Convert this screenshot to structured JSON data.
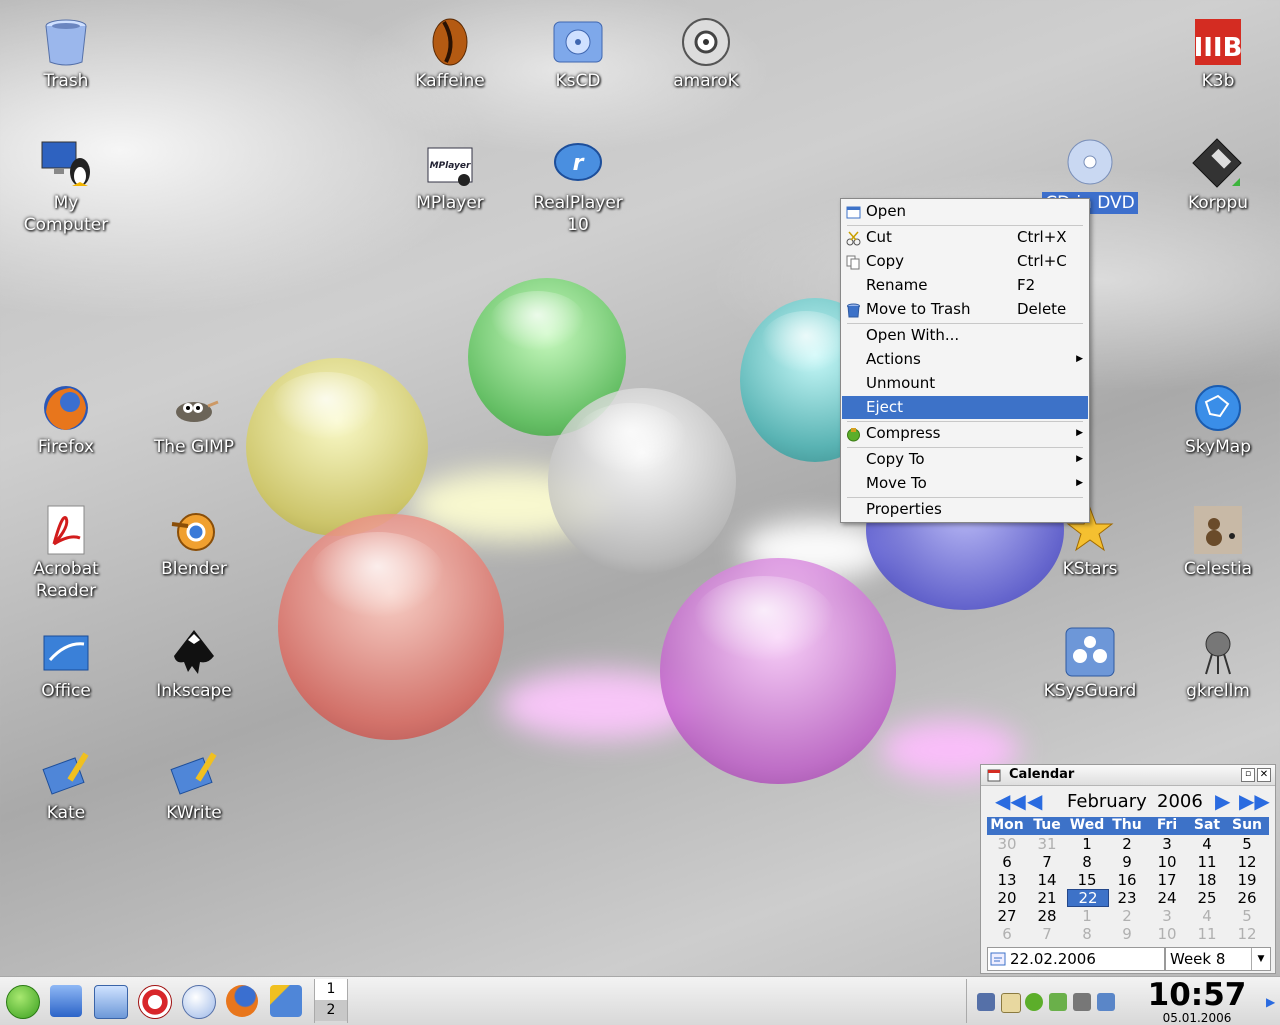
{
  "desktop": {
    "icons": [
      {
        "label": "Trash",
        "icon": "trash-icon"
      },
      {
        "label": "Kaffeine",
        "icon": "kaffeine-icon"
      },
      {
        "label": "KsCD",
        "icon": "kscd-icon"
      },
      {
        "label": "amaroK",
        "icon": "amarok-icon"
      },
      {
        "label": "K3b",
        "icon": "k3b-icon"
      },
      {
        "label": "My\nComputer",
        "icon": "my-computer-icon"
      },
      {
        "label": "MPlayer",
        "icon": "mplayer-icon"
      },
      {
        "label": "RealPlayer\n10",
        "icon": "realplayer-icon"
      },
      {
        "label": "CD-in DVD",
        "icon": "dvd-drive-icon"
      },
      {
        "label": "Korppu",
        "icon": "floppy-icon"
      },
      {
        "label": "Firefox",
        "icon": "firefox-icon"
      },
      {
        "label": "The GIMP",
        "icon": "gimp-icon"
      },
      {
        "label": "SkyMap",
        "icon": "skymap-icon"
      },
      {
        "label": "Acrobat\nReader",
        "icon": "acrobat-icon"
      },
      {
        "label": "Blender",
        "icon": "blender-icon"
      },
      {
        "label": "KStars",
        "icon": "kstars-icon"
      },
      {
        "label": "Celestia",
        "icon": "celestia-icon"
      },
      {
        "label": "Office",
        "icon": "office-icon"
      },
      {
        "label": "Inkscape",
        "icon": "inkscape-icon"
      },
      {
        "label": "KSysGuard",
        "icon": "ksysguard-icon"
      },
      {
        "label": "gkrellm",
        "icon": "gkrellm-icon"
      },
      {
        "label": "Kate",
        "icon": "kate-icon"
      },
      {
        "label": "KWrite",
        "icon": "kwrite-icon"
      }
    ]
  },
  "context_menu": {
    "items": [
      {
        "label": "Open",
        "shortcut": "",
        "icon": "open-icon"
      },
      {
        "label": "Cut",
        "shortcut": "Ctrl+X",
        "icon": "cut-icon"
      },
      {
        "label": "Copy",
        "shortcut": "Ctrl+C",
        "icon": "copy-icon"
      },
      {
        "label": "Rename",
        "shortcut": "F2",
        "icon": ""
      },
      {
        "label": "Move to Trash",
        "shortcut": "Delete",
        "icon": "trash-icon"
      },
      {
        "label": "Open With...",
        "shortcut": "",
        "icon": ""
      },
      {
        "label": "Actions",
        "shortcut": "",
        "icon": ""
      },
      {
        "label": "Unmount",
        "shortcut": "",
        "icon": ""
      },
      {
        "label": "Eject",
        "shortcut": "",
        "icon": ""
      },
      {
        "label": "Compress",
        "shortcut": "",
        "icon": "compress-icon"
      },
      {
        "label": "Copy To",
        "shortcut": "",
        "icon": ""
      },
      {
        "label": "Move To",
        "shortcut": "",
        "icon": ""
      },
      {
        "label": "Properties",
        "shortcut": "",
        "icon": ""
      }
    ],
    "highlighted": "Eject"
  },
  "calendar": {
    "title": "Calendar",
    "month": "February",
    "year": "2006",
    "weekdays": [
      "Mon",
      "Tue",
      "Wed",
      "Thu",
      "Fri",
      "Sat",
      "Sun"
    ],
    "weeks": [
      [
        "30",
        "31",
        "1",
        "2",
        "3",
        "4",
        "5"
      ],
      [
        "6",
        "7",
        "8",
        "9",
        "10",
        "11",
        "12"
      ],
      [
        "13",
        "14",
        "15",
        "16",
        "17",
        "18",
        "19"
      ],
      [
        "20",
        "21",
        "22",
        "23",
        "24",
        "25",
        "26"
      ],
      [
        "27",
        "28",
        "1",
        "2",
        "3",
        "4",
        "5"
      ],
      [
        "6",
        "7",
        "8",
        "9",
        "10",
        "11",
        "12"
      ]
    ],
    "selected_day": "22",
    "date_field": "22.02.2006",
    "week_field": "Week 8"
  },
  "panel": {
    "pager": [
      "1",
      "2"
    ],
    "active_desktop": "1",
    "clock_time": "10:57",
    "clock_date": "05.01.2006",
    "quick_launch": [
      "suse-menu-icon",
      "home-icon",
      "desktop-icon",
      "help-icon",
      "kmail-icon",
      "firefox-icon",
      "kate-icon"
    ],
    "tray_icons": [
      "network-icon",
      "klipper-icon",
      "suse-updater-icon",
      "display-icon",
      "volume-icon",
      "settings-icon"
    ]
  },
  "colors": {
    "selection": "#3d72c8",
    "calendar_accent": "#2a6be0"
  }
}
